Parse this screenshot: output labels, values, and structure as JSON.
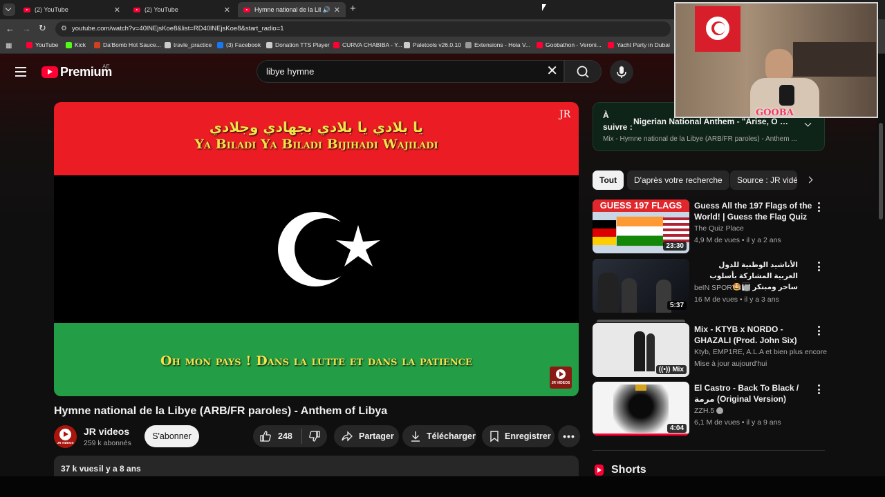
{
  "browser": {
    "tabs": [
      {
        "title": "(2) YouTube"
      },
      {
        "title": "(2) YouTube"
      },
      {
        "title": "Hymne national de la Libye"
      }
    ],
    "url": "youtube.com/watch?v=40lNEjsKoe8&list=RD40lNEjsKoe8&start_radio=1",
    "bookmarks": [
      {
        "label": "YouTube",
        "color": "#ff0033"
      },
      {
        "label": "Kick",
        "color": "#53fc18"
      },
      {
        "label": "Da'Bomb Hot Sauce...",
        "color": "#d04020"
      },
      {
        "label": "travle_practice",
        "color": "#cccccc"
      },
      {
        "label": "(3) Facebook",
        "color": "#1877f2"
      },
      {
        "label": "Donation TTS Player",
        "color": "#cccccc"
      },
      {
        "label": "CURVA CHABIBA - Y...",
        "color": "#ff0033"
      },
      {
        "label": "Paletools v26.0.10",
        "color": "#cccccc"
      },
      {
        "label": "Extensions - Hola V...",
        "color": "#999999"
      },
      {
        "label": "Goobathon - Veroni...",
        "color": "#ff0033"
      },
      {
        "label": "Yacht Party in Dubai",
        "color": "#ff0033"
      }
    ]
  },
  "header": {
    "logo": "Premium",
    "region": "AE",
    "search_value": "libye hymne"
  },
  "video": {
    "watermark": "JR",
    "arabic_lyric": "يا بلادي يا بلادي بجهادي وجلادي",
    "translit_lyric": "Ya Biladi Ya Biladi Bijihadi Wajiladi",
    "french_lyric": "Oh mon pays ! Dans la lutte et dans la patience",
    "corner_logo": "JR VIDEOS",
    "flag_colors": {
      "red": "#ec1c24",
      "black": "#000000",
      "green": "#239e46"
    }
  },
  "meta": {
    "title": "Hymne national de la Libye (ARB/FR paroles) - Anthem of Libya",
    "channel": "JR videos",
    "channel_avatar_text": "JR VIDEOS",
    "subscribers": "259 k abonnés",
    "subscribe_label": "S'abonner",
    "likes": "248",
    "share_label": "Partager",
    "download_label": "Télécharger",
    "save_label": "Enregistrer",
    "views": "37 k vues",
    "age": "il y a 8 ans"
  },
  "upnext": {
    "prefix_line1": "À",
    "prefix_line2": "suivre :",
    "title": "Nigerian National Anthem - \"Arise, O Com...",
    "subtitle": "Mix - Hymne national de la Libye (ARB/FR paroles) - Anthem ..."
  },
  "chips": [
    "Tout",
    "D'après votre recherche",
    "Source : JR vidéos"
  ],
  "recommendations": [
    {
      "title": "Guess All the 197 Flags of the World! | Guess the Flag Quiz",
      "channel": "The Quiz Place",
      "meta": "4,9 M de vues • il y a 2 ans",
      "duration": "23:30",
      "thumb_text": "GUESS 197 FLAGS",
      "verified": false
    },
    {
      "title": "الأناشيد الوطنية للدول العربية المشاركة بأسلوب ساحر ومبتكر 🎹🤩",
      "channel": "beIN SPORTS",
      "meta": "16 M de vues • il y a 3 ans",
      "duration": "5:37",
      "verified": true
    },
    {
      "title": "Mix - KTYB x NORDO - GHAZALI (Prod. John Six)",
      "channel": "Ktyb, EMP1RE, A.L.A et bien plus encore",
      "meta": "Mise à jour aujourd'hui",
      "duration": "Mix",
      "verified": false
    },
    {
      "title": "El Castro - Back To Black / مرمة (Original Version)",
      "channel": "ZZH.5",
      "meta": "6,1 M de vues • il y a 9 ans",
      "duration": "4:04",
      "verified": true
    }
  ],
  "shorts_label": "Shorts",
  "webcam": {
    "overlay_text": "GOOBA"
  }
}
